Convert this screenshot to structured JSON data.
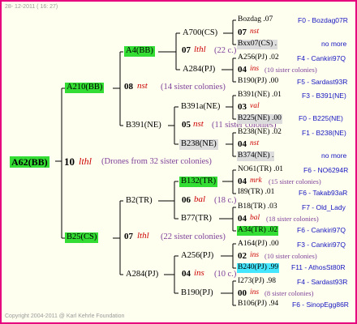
{
  "header": {
    "date": "28- 12-2011 ( 16: 27)"
  },
  "footer": {
    "copyright": "Copyright 2004-2011 @ Karl Kehrle Foundation"
  },
  "root": {
    "name": "A62(BB)",
    "year": "10",
    "breed": "lthl",
    "note": "(Drones from 32 sister colonies)"
  },
  "queen": {
    "name": "A210(BB)",
    "year": "08",
    "breed": "nst",
    "note": "(14 sister colonies)"
  },
  "drone": {
    "name": "B25(CS)",
    "year": "07",
    "breed": "lthl",
    "note": "(22 sister colonies)"
  },
  "q_mother": {
    "name": "A4(BB)",
    "year": "07",
    "breed": "lthl",
    "note": "(22 c.)"
  },
  "q_father": {
    "name": "B391(NE)",
    "year": "05",
    "breed": "nst",
    "note": "(11 sister colonies)"
  },
  "d_mother": {
    "name": "B2(TR)",
    "year": "06",
    "breed": "bal",
    "note": "(18 c.)"
  },
  "d_father": {
    "name": "A284(PJ)",
    "year": "04",
    "breed": "ins",
    "note": "(10 c.)"
  },
  "g1": {
    "name": "A700(CS)"
  },
  "g2": {
    "name": "A284(PJ)"
  },
  "g3": {
    "name": "B391a(NE)"
  },
  "g4": {
    "name": "B238(NE)"
  },
  "g5": {
    "name": "B132(TR)"
  },
  "g6": {
    "name": "B77(TR)"
  },
  "g7": {
    "name": "A256(PJ)"
  },
  "g8": {
    "name": "B190(PJ)"
  },
  "rows": [
    {
      "name": "Bozdag",
      "year": ".07",
      "code": "F0 - Bozdag07R"
    },
    {
      "name": "07",
      "breed": "nst",
      "note": ""
    },
    {
      "name": "Bxx07(CS)",
      "year": ".",
      "code": "no more"
    },
    {
      "name": "A256(PJ)",
      "year": ".02",
      "code": "F4 - Cankiri97Q"
    },
    {
      "name": "04",
      "breed": "ins",
      "note": "(10 sister colonies)"
    },
    {
      "name": "B190(PJ)",
      "year": ".00",
      "code": "F5 - Sardast93R"
    },
    {
      "name": "B391(NE)",
      "year": ".01",
      "code": "F3 - B391(NE)"
    },
    {
      "name": "03",
      "breed": "val",
      "note": ""
    },
    {
      "name": "B225(NE)",
      "year": ".00",
      "code": "F0 - B225(NE)"
    },
    {
      "name": "B238(NE)",
      "year": ".02",
      "code": "F1 - B238(NE)"
    },
    {
      "name": "04",
      "breed": "nst",
      "note": ""
    },
    {
      "name": "B374(NE)",
      "year": ".",
      "code": "no more"
    },
    {
      "name": "NO61(TR)",
      "year": ".01",
      "code": "F6 - NO6294R"
    },
    {
      "name": "04",
      "breed": "mrk",
      "note": "(15 sister colonies)"
    },
    {
      "name": "I89(TR)",
      "year": ".01",
      "code": "F6 - Takab93aR"
    },
    {
      "name": "B18(TR)",
      "year": ".03",
      "code": "F7 - Old_Lady"
    },
    {
      "name": "04",
      "breed": "bal",
      "note": "(18 sister colonies)"
    },
    {
      "name": "A34(TR)",
      "year": ".02",
      "code": "F6 - Cankiri97Q"
    },
    {
      "name": "A164(PJ)",
      "year": ".00",
      "code": "F3 - Cankiri97Q"
    },
    {
      "name": "02",
      "breed": "ins",
      "note": "(10 sister colonies)"
    },
    {
      "name": "B240(PJ)",
      "year": ".99",
      "code": "F11 - AthosSt80R"
    },
    {
      "name": "I273(PJ)",
      "year": ".98",
      "code": "F4 - Sardast93R"
    },
    {
      "name": "00",
      "breed": "ins",
      "note": "(8 sister colonies)"
    },
    {
      "name": "B106(PJ)",
      "year": ".94",
      "code": "F6 - SinopEgg86R"
    }
  ]
}
